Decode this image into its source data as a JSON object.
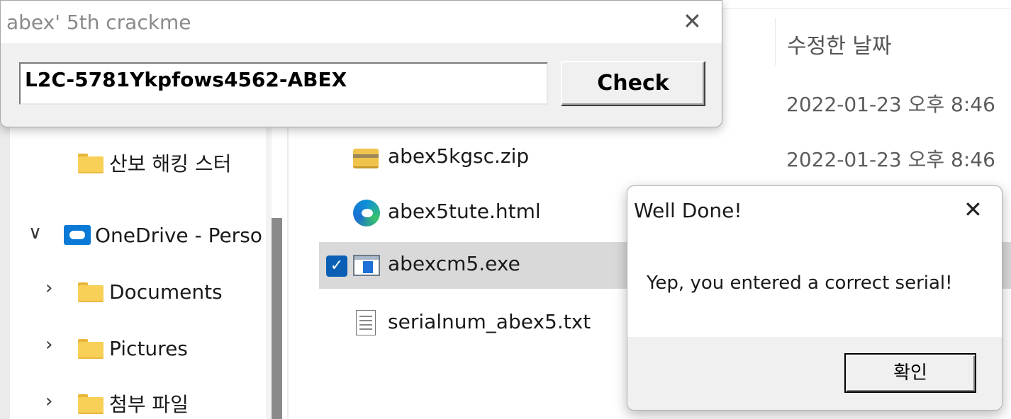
{
  "crackme_window": {
    "title": "abex' 5th crackme",
    "close_glyph": "✕",
    "serial_value": "L2C-5781Ykpfows4562-ABEX",
    "check_label": "Check"
  },
  "explorer": {
    "column_header": "수정한 날짜",
    "nav_items": [
      {
        "label": "산보 해킹 스터",
        "icon": "folder-icon"
      },
      {
        "label": "OneDrive - Perso",
        "icon": "onedrive-icon",
        "chevron": "∨"
      },
      {
        "label": "Documents",
        "icon": "folder-icon",
        "chevron": "›"
      },
      {
        "label": "Pictures",
        "icon": "folder-icon",
        "chevron": "›"
      },
      {
        "label": "첨부 파일",
        "icon": "folder-icon",
        "chevron": "›"
      }
    ],
    "files": [
      {
        "name": "",
        "date": "2022-01-23 오후 8:46"
      },
      {
        "name": "abex5kgsc.zip",
        "date": "2022-01-23 오후 8:46",
        "icon": "zip-icon"
      },
      {
        "name": "abex5tute.html",
        "date": "",
        "icon": "edge-icon"
      },
      {
        "name": "abexcm5.exe",
        "date": "",
        "icon": "exe-icon",
        "selected": true,
        "check_glyph": "✓"
      },
      {
        "name": "serialnum_abex5.txt",
        "date": "",
        "icon": "text-file-icon"
      }
    ]
  },
  "message_box": {
    "title": "Well Done!",
    "close_glyph": "✕",
    "message": "Yep, you entered a correct serial!",
    "ok_label": "확인"
  }
}
